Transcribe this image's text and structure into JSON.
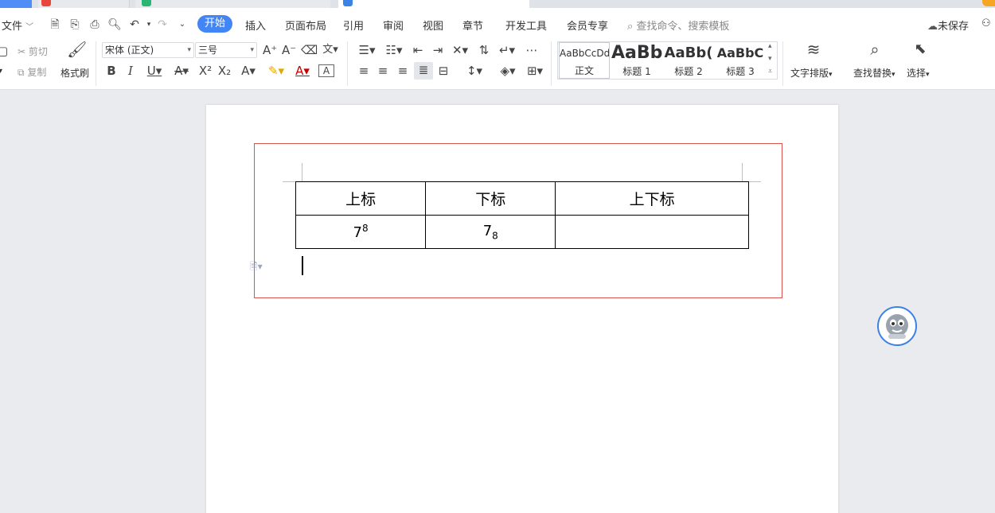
{
  "menubar": {
    "file": "文件",
    "tabs": [
      "开始",
      "插入",
      "页面布局",
      "引用",
      "审阅",
      "视图",
      "章节",
      "开发工具",
      "会员专享"
    ],
    "search_placeholder": "查找命令、搜索模板",
    "unsaved": "未保存"
  },
  "ribbon": {
    "cut": "剪切",
    "copy": "复制",
    "format_painter": "格式刷",
    "font_name": "宋体 (正文)",
    "font_size": "三号",
    "styles": [
      {
        "preview": "AaBbCcDd",
        "label": "正文"
      },
      {
        "preview": "AaBb",
        "label": "标题 1"
      },
      {
        "preview": "AaBb(",
        "label": "标题 2"
      },
      {
        "preview": "AaBbC",
        "label": "标题 3"
      }
    ],
    "text_layout": "文字排版",
    "find_replace": "查找替换",
    "select": "选择"
  },
  "document": {
    "table": {
      "headers": [
        "上标",
        "下标",
        "上下标"
      ],
      "row": {
        "sup_base": "7",
        "sup_exp": "8",
        "sub_base": "7",
        "sub_exp": "8",
        "supsub": ""
      }
    }
  },
  "colors": {
    "accent": "#4285f4",
    "selection_border": "#d9534f"
  },
  "icons": [
    "save-icon",
    "print-icon",
    "undo-icon",
    "redo-icon",
    "search-icon",
    "cloud-icon",
    "assistant-icon"
  ]
}
